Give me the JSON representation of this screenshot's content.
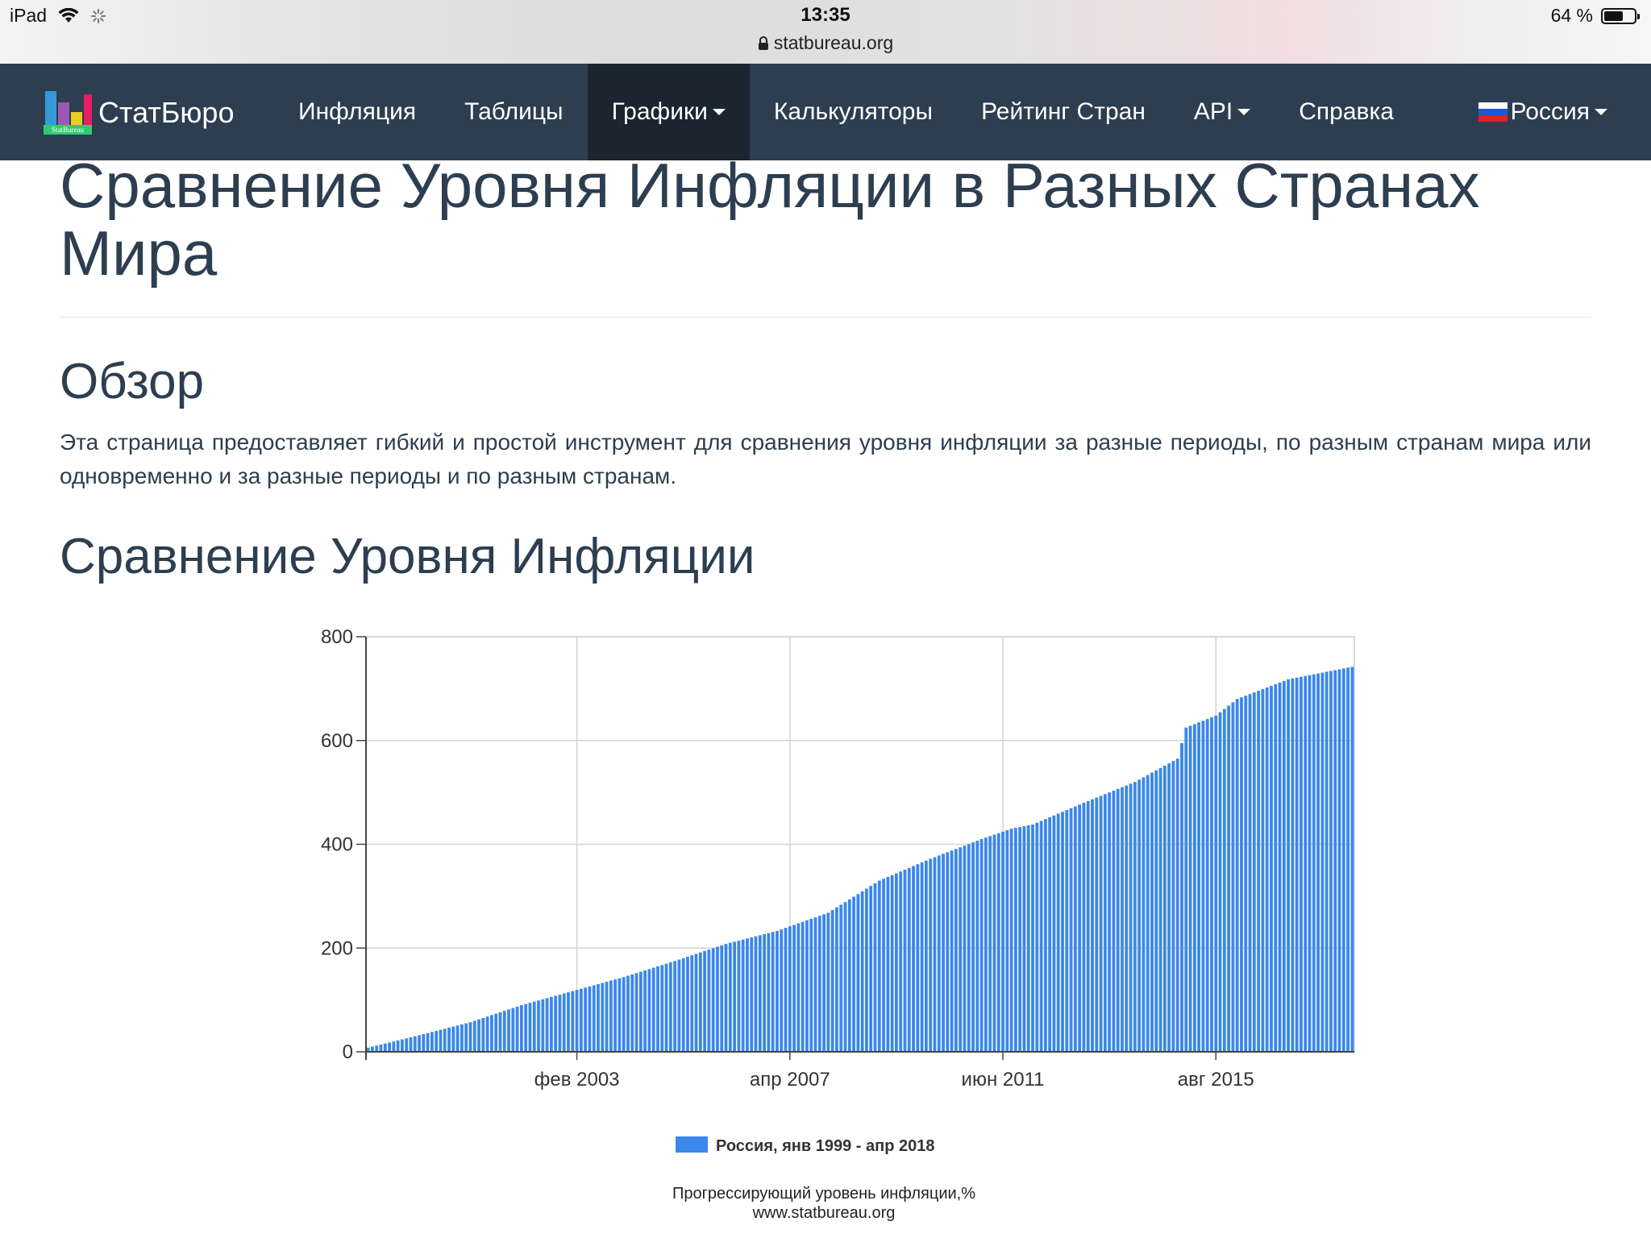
{
  "status_bar": {
    "device": "iPad",
    "time": "13:35",
    "url": "statbureau.org",
    "battery_text": "64 %",
    "battery_level": 0.64
  },
  "navbar": {
    "brand": "СтатБюро",
    "logo_text": "StatBureau",
    "items": [
      {
        "label": "Инфляция"
      },
      {
        "label": "Таблицы"
      },
      {
        "label": "Графики",
        "dropdown": true,
        "active": true
      },
      {
        "label": "Калькуляторы"
      },
      {
        "label": "Рейтинг Стран"
      },
      {
        "label": "API",
        "dropdown": true
      },
      {
        "label": "Справка"
      }
    ],
    "country": "Россия"
  },
  "page": {
    "title": "Сравнение Уровня Инфляции в Разных Странах Мира",
    "overview_heading": "Обзор",
    "overview_text": "Эта страница предоставляет гибкий и простой инструмент для сравнения уровня инфляции за разные периоды, по разным странам мира или одновременно и за разные периоды и по разным странам.",
    "comparison_heading": "Сравнение Уровня Инфляции"
  },
  "colors": {
    "navbar": "#2c3e50",
    "navbar_active": "#1a252f",
    "bar": "#3b87ea",
    "text": "#2c3e50"
  },
  "chart_data": {
    "type": "bar",
    "x_range": [
      "янв 1999",
      "апр 2018"
    ],
    "xticks": [
      "фев 2003",
      "апр 2007",
      "июн 2011",
      "авг 2015"
    ],
    "yticks": [
      "0",
      "200",
      "400",
      "600",
      "800"
    ],
    "ylim": [
      0,
      800
    ],
    "grid": true,
    "legend_position": "bottom",
    "series": [
      {
        "name": "Россия, янв 1999 - апр 2018",
        "color": "#3b87ea",
        "anchors": [
          {
            "date": "1999-01",
            "value": 8
          },
          {
            "date": "2000-01",
            "value": 32
          },
          {
            "date": "2001-01",
            "value": 57
          },
          {
            "date": "2002-01",
            "value": 90
          },
          {
            "date": "2003-01",
            "value": 117
          },
          {
            "date": "2004-01",
            "value": 144
          },
          {
            "date": "2005-01",
            "value": 175
          },
          {
            "date": "2006-01",
            "value": 208
          },
          {
            "date": "2007-01",
            "value": 233
          },
          {
            "date": "2008-01",
            "value": 268
          },
          {
            "date": "2009-01",
            "value": 330
          },
          {
            "date": "2010-01",
            "value": 372
          },
          {
            "date": "2011-01",
            "value": 410
          },
          {
            "date": "2011-08",
            "value": 430
          },
          {
            "date": "2012-01",
            "value": 438
          },
          {
            "date": "2013-01",
            "value": 480
          },
          {
            "date": "2014-01",
            "value": 520
          },
          {
            "date": "2014-11",
            "value": 565
          },
          {
            "date": "2015-01",
            "value": 625
          },
          {
            "date": "2015-08",
            "value": 648
          },
          {
            "date": "2016-01",
            "value": 680
          },
          {
            "date": "2017-01",
            "value": 718
          },
          {
            "date": "2018-04",
            "value": 742
          }
        ]
      }
    ],
    "footer_line1": "Прогрессирующий уровень инфляции,%",
    "footer_line2": "www.statbureau.org"
  }
}
